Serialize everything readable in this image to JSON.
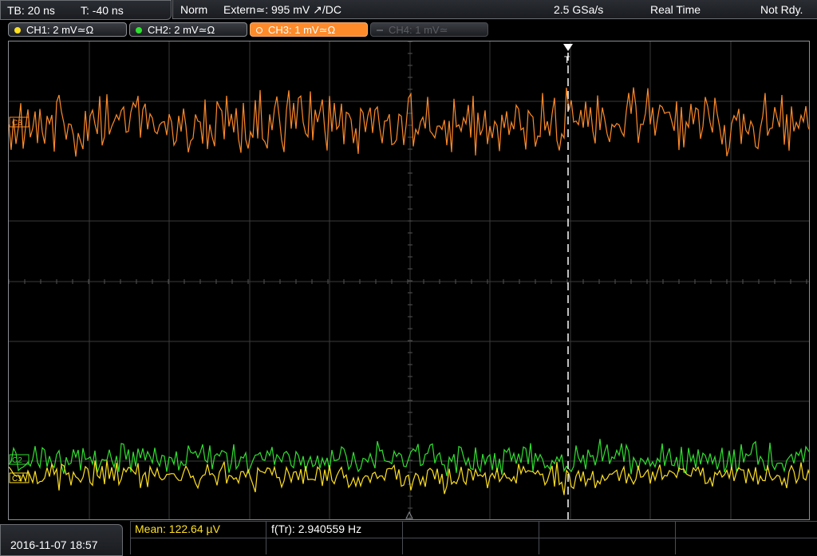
{
  "timebase": {
    "tb_label": "TB: 20 ns",
    "t_label": "T: -40 ns"
  },
  "status": {
    "mode": "Norm",
    "trigger": "Extern≃: 995 mV ↗/DC",
    "sample_rate": "2.5 GSa/s",
    "acq_mode": "Real Time",
    "state": "Not Rdy."
  },
  "channels": [
    {
      "label": "CH1: 2 mV≃Ω",
      "color": "#ffe020",
      "active": false,
      "enabled": true
    },
    {
      "label": "CH2: 2 mV≃Ω",
      "color": "#30e030",
      "active": false,
      "enabled": true
    },
    {
      "label": "CH3: 1 mV≃Ω",
      "color": "#ff8a2a",
      "active": true,
      "enabled": true
    },
    {
      "label": "CH4: 1 mV≃",
      "color": "#5a5d62",
      "active": false,
      "enabled": false
    }
  ],
  "markers": {
    "trigger_marker": "T",
    "ch3_marker": "C3",
    "ch2_marker": "C2",
    "ch1_marker": "C1"
  },
  "datetime": "2016-11-07 18:57",
  "measurements": {
    "mean": "Mean: 122.64 µV",
    "freq": "f(Tr): 2.940559 Hz"
  },
  "colors": {
    "ch1": "#ffe020",
    "ch2": "#30e030",
    "ch3": "#ff8a2a",
    "grid": "#3a3a3a",
    "trigger_line": "#ffffff"
  }
}
